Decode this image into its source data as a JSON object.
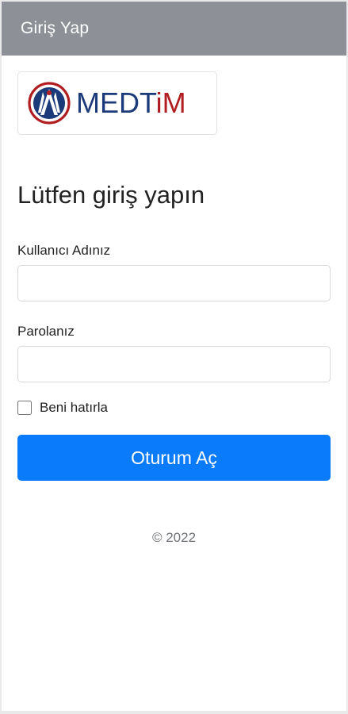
{
  "header": {
    "title": "Giriş Yap"
  },
  "logo": {
    "wordmark_main": "MEDT",
    "wordmark_accent": "iM",
    "colors": {
      "red": "#b01e22",
      "blue": "#1b3a7a"
    }
  },
  "form": {
    "heading": "Lütfen giriş yapın",
    "username_label": "Kullanıcı Adınız",
    "username_value": "",
    "username_placeholder": "",
    "password_label": "Parolanız",
    "password_value": "",
    "password_placeholder": "",
    "remember_label": "Beni hatırla",
    "remember_checked": false,
    "submit_label": "Oturum Aç"
  },
  "footer": {
    "copyright": "© 2022"
  },
  "colors": {
    "header_bg": "#8d9096",
    "primary": "#0a7bfb",
    "text": "#222222",
    "muted": "#6f7377"
  }
}
